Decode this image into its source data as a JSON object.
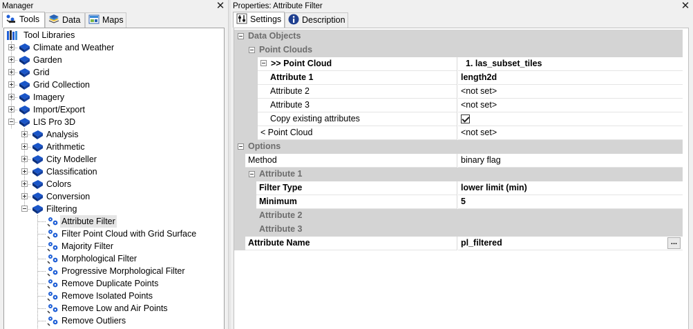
{
  "manager": {
    "title": "Manager",
    "close": "✕",
    "tabs": [
      {
        "label": "Tools",
        "icon": "tools-icon"
      },
      {
        "label": "Data",
        "icon": "data-icon"
      },
      {
        "label": "Maps",
        "icon": "maps-icon"
      }
    ],
    "tree": {
      "root": "Tool Libraries",
      "items": [
        "Climate and Weather",
        "Garden",
        "Grid",
        "Grid Collection",
        "Imagery",
        "Import/Export",
        "LIS Pro 3D"
      ],
      "lis_children": [
        "Analysis",
        "Arithmetic",
        "City Modeller",
        "Classification",
        "Colors",
        "Conversion",
        "Filtering"
      ],
      "filtering_tools": [
        "Attribute Filter",
        "Filter Point Cloud with Grid Surface",
        "Majority Filter",
        "Morphological Filter",
        "Progressive Morphological Filter",
        "Remove Duplicate Points",
        "Remove Isolated Points",
        "Remove Low and Air Points",
        "Remove Outliers"
      ]
    }
  },
  "properties": {
    "title": "Properties: Attribute Filter",
    "close": "✕",
    "tabs": [
      {
        "label": "Settings",
        "icon": "settings-icon"
      },
      {
        "label": "Description",
        "icon": "info-icon"
      }
    ],
    "cats": {
      "data_objects": "Data Objects",
      "point_clouds": "Point Clouds",
      "options": "Options",
      "attribute1": "Attribute 1",
      "attribute2": "Attribute 2",
      "attribute3": "Attribute 3"
    },
    "rows": {
      "input_pc": {
        "name": ">> Point Cloud",
        "value": "1. las_subset_tiles"
      },
      "attr1": {
        "name": "Attribute 1",
        "value": "length2d"
      },
      "attr2": {
        "name": "Attribute 2",
        "value": "<not set>"
      },
      "attr3": {
        "name": "Attribute 3",
        "value": "<not set>"
      },
      "copy": {
        "name": "Copy existing attributes",
        "checked": true
      },
      "output_pc": {
        "name": "< Point Cloud",
        "value": "<not set>"
      },
      "method": {
        "name": "Method",
        "value": "binary flag"
      },
      "filter_type": {
        "name": "Filter Type",
        "value": "lower limit (min)"
      },
      "minimum": {
        "name": "Minimum",
        "value": "5"
      },
      "attr_name": {
        "name": "Attribute Name",
        "value": "pl_filtered",
        "button": "..."
      }
    }
  }
}
